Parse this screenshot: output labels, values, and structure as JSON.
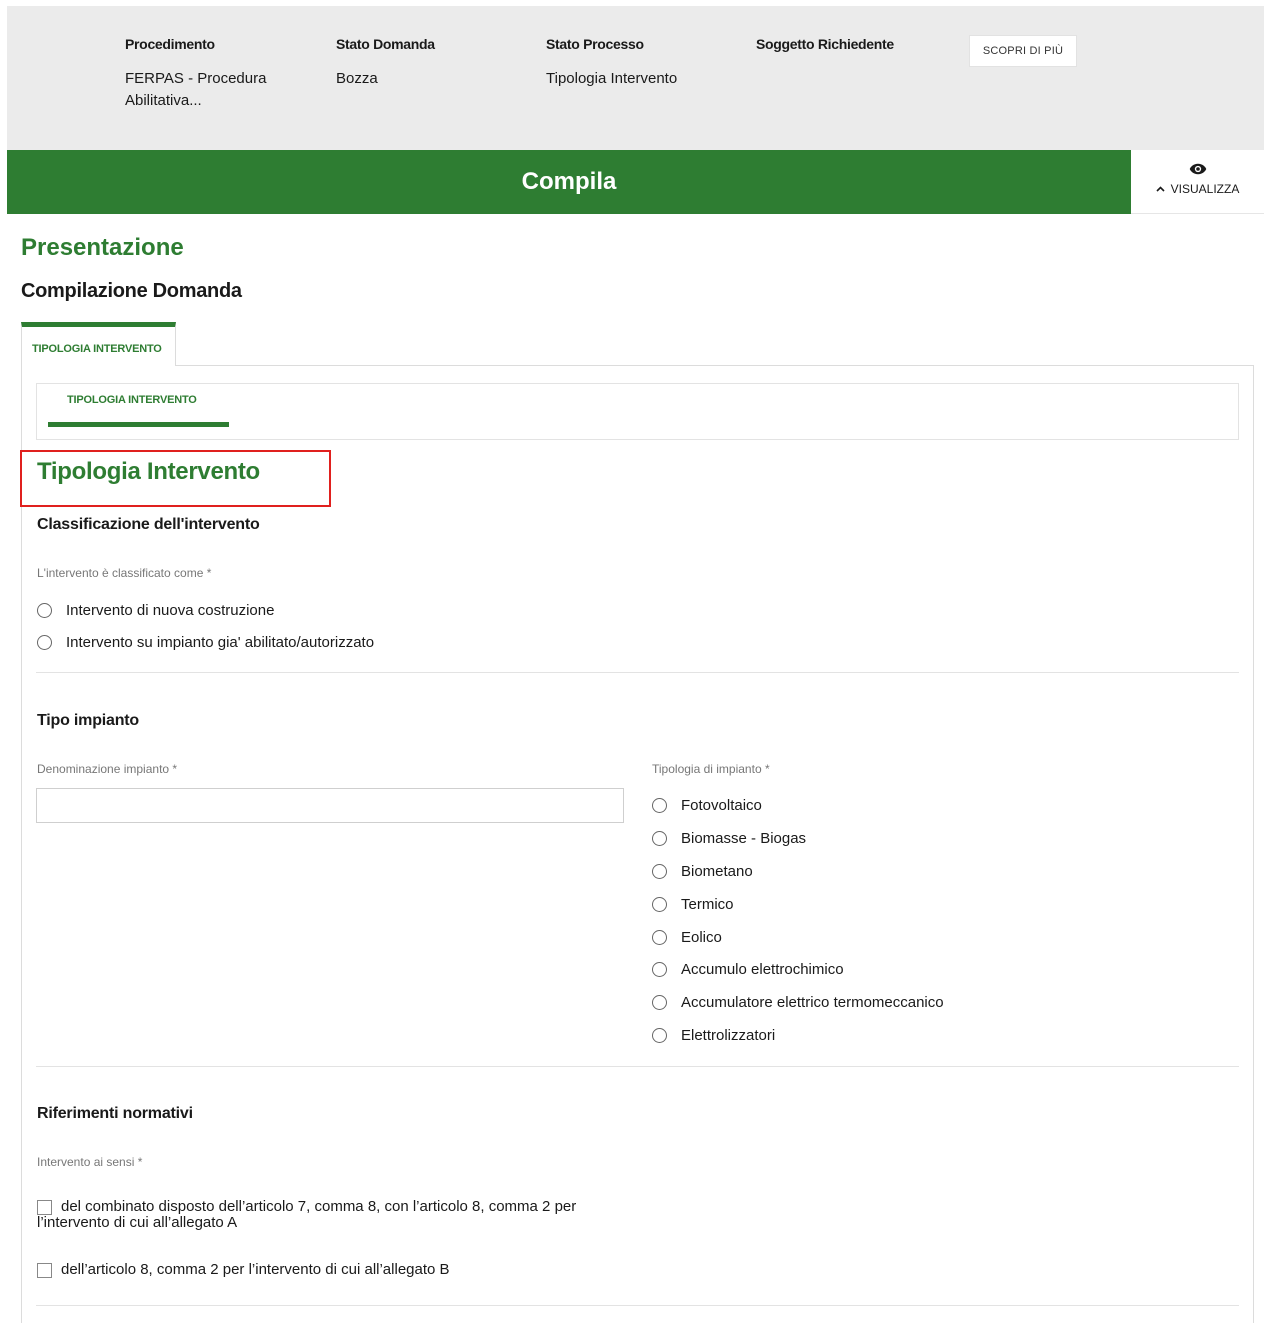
{
  "header": {
    "procedimento_label": "Procedimento",
    "procedimento_value": "FERPAS - Procedura Abilitativa...",
    "stato_domanda_label": "Stato Domanda",
    "stato_domanda_value": "Bozza",
    "stato_processo_label": "Stato Processo",
    "stato_processo_value": "Tipologia Intervento",
    "soggetto_label": "Soggetto Richiedente",
    "scopri_label": "SCOPRI DI PIÙ"
  },
  "bar": {
    "title": "Compila",
    "visualizza_label": "VISUALIZZA"
  },
  "page": {
    "title": "Presentazione",
    "subtitle": "Compilazione Domanda",
    "tab_label": "TIPOLOGIA INTERVENTO",
    "subtab_label": "TIPOLOGIA INTERVENTO",
    "section_title": "Tipologia Intervento"
  },
  "classificazione": {
    "heading": "Classificazione dell'intervento",
    "field_label": "L'intervento è classificato come *",
    "options": [
      "Intervento di nuova costruzione",
      "Intervento su impianto gia' abilitato/autorizzato"
    ]
  },
  "tipo_impianto": {
    "heading": "Tipo impianto",
    "denominazione_label": "Denominazione impianto *",
    "denominazione_value": "",
    "tipologia_label": "Tipologia di impianto *",
    "options": [
      "Fotovoltaico",
      "Biomasse - Biogas",
      "Biometano",
      "Termico",
      "Eolico",
      "Accumulo elettrochimico",
      "Accumulatore elettrico termomeccanico",
      "Elettrolizzatori"
    ]
  },
  "riferimenti": {
    "heading": "Riferimenti normativi",
    "field_label": "Intervento ai sensi *",
    "options": [
      "del combinato disposto dell’articolo 7, comma 8, con l’articolo 8, comma 2 per l’intervento di cui all’allegato A",
      "dell’articolo 8, comma 2 per l’intervento di cui all’allegato B"
    ]
  },
  "colors": {
    "primary_green": "#2e7d32",
    "highlight_red": "#e0201e",
    "header_bg": "#ebebeb"
  }
}
